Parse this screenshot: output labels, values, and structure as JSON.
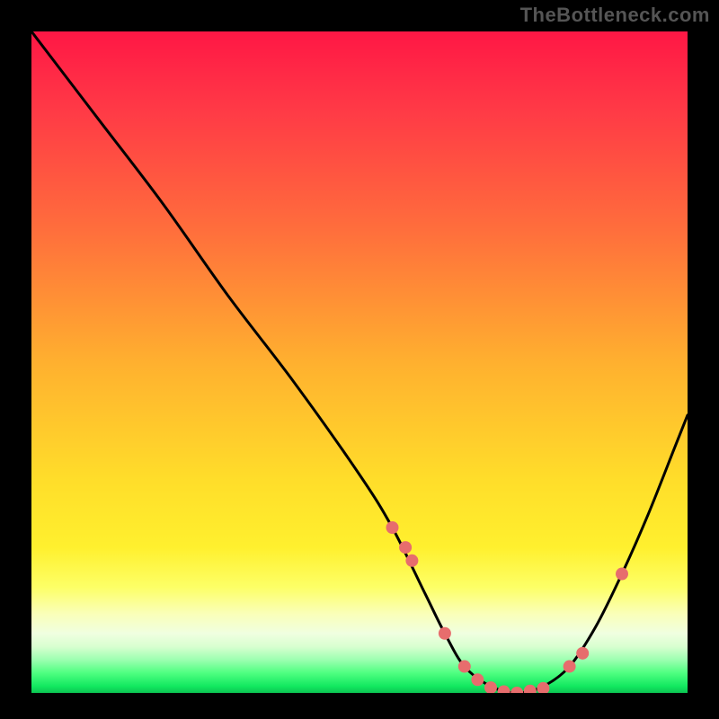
{
  "watermark": "TheBottleneck.com",
  "colors": {
    "background": "#000000",
    "curve_stroke": "#000000",
    "dot_fill": "#e76d6d",
    "gradient_top": "#ff1745",
    "gradient_mid": "#ffde2a",
    "gradient_bottom": "#0cc552"
  },
  "chart_data": {
    "type": "line",
    "title": "",
    "xlabel": "",
    "ylabel": "",
    "xlim": [
      0,
      100
    ],
    "ylim": [
      0,
      100
    ],
    "series": [
      {
        "name": "bottleneck-curve",
        "x": [
          0,
          10,
          20,
          30,
          40,
          50,
          55,
          60,
          63,
          66,
          70,
          74,
          78,
          82,
          86,
          90,
          94,
          98,
          100
        ],
        "values": [
          100,
          87,
          74,
          60,
          47,
          33,
          25,
          15,
          9,
          4,
          1,
          0,
          1,
          4,
          10,
          18,
          27,
          37,
          42
        ]
      }
    ],
    "dots": {
      "name": "highlight-points",
      "x": [
        55,
        57,
        58,
        63,
        66,
        68,
        70,
        72,
        74,
        76,
        78,
        82,
        84,
        90
      ],
      "values": [
        25,
        22,
        20,
        9,
        4,
        2,
        0.8,
        0.2,
        0,
        0.3,
        0.7,
        4,
        6,
        18
      ]
    }
  }
}
